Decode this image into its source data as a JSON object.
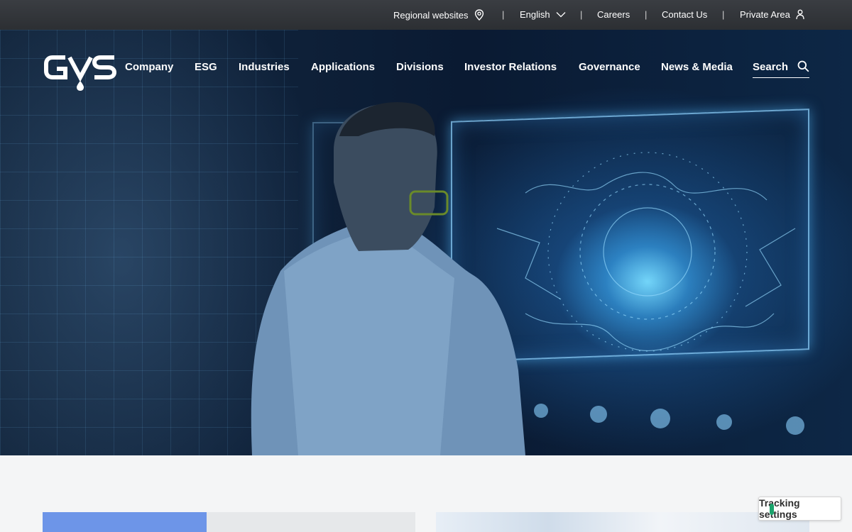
{
  "topbar": {
    "regional": "Regional websites",
    "language": "English",
    "careers": "Careers",
    "contact": "Contact Us",
    "private_area": "Private Area",
    "separator": "|"
  },
  "nav": {
    "logo_text": "GVS",
    "items": [
      "Company",
      "ESG",
      "Industries",
      "Applications",
      "Divisions",
      "Investor Relations",
      "Governance",
      "News & Media"
    ],
    "search": "Search"
  },
  "carousel": {
    "slides": 5
  },
  "tracking": {
    "label": "Tracking settings"
  },
  "colors": {
    "topbar": "#2f3236",
    "accent_blue": "#6d95e8",
    "tracking_knob": "#1aa36b"
  }
}
